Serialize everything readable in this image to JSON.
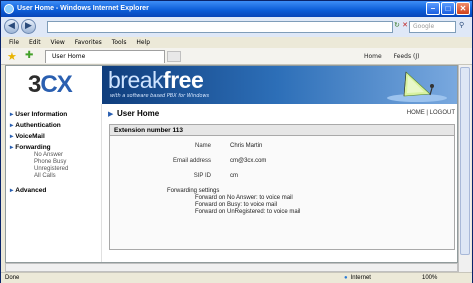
{
  "window": {
    "title": "User Home - Windows Internet Explorer"
  },
  "browser": {
    "address_value": "",
    "search_placeholder": "Google",
    "menu": [
      "File",
      "Edit",
      "View",
      "Favorites",
      "Tools",
      "Help"
    ],
    "tab_title": "User Home",
    "commands": [
      "Home",
      "Feeds (J)"
    ],
    "status_text": "Done",
    "zone": "Internet",
    "zoom": "100%"
  },
  "banner": {
    "logo_prefix": "3",
    "logo_suffix": "CX",
    "brand_light": "break",
    "brand_bold": "free",
    "tagline": "with a software based PBX for Windows"
  },
  "sidebar": {
    "items": [
      {
        "label": "User Information"
      },
      {
        "label": "Authentication"
      },
      {
        "label": "VoiceMail"
      },
      {
        "label": "Forwarding"
      }
    ],
    "subitems": [
      "No Answer",
      "Phone Busy",
      "Unregistered",
      "All Calls"
    ],
    "advanced": "Advanced"
  },
  "main": {
    "title": "User Home",
    "links": "HOME | LOGOUT",
    "section_title": "Extension number 113",
    "fields": [
      {
        "label": "Name",
        "value": "Chris Martin"
      },
      {
        "label": "Email address",
        "value": "cm@3cx.com"
      },
      {
        "label": "SIP ID",
        "value": "cm"
      }
    ],
    "forwarding_label": "Forwarding settings",
    "forwarding_lines": [
      "Forward on No Answer: to voice mail",
      "Forward on Busy: to voice mail",
      "Forward on UnRegistered: to voice mail"
    ]
  },
  "colors": {
    "titlebar": "#0a5bd6",
    "accent": "#2a5fb0",
    "banner": "#0f3d7c"
  }
}
